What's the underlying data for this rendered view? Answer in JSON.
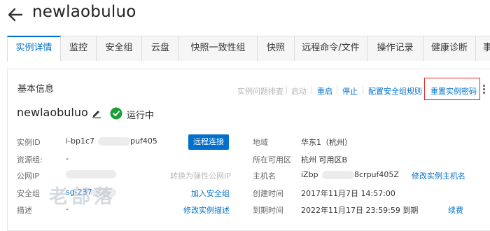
{
  "header": {
    "title": "newlaobuluo"
  },
  "tabs": [
    {
      "label": "实例详情"
    },
    {
      "label": "监控"
    },
    {
      "label": "安全组"
    },
    {
      "label": "云盘"
    },
    {
      "label": "快照一致性组"
    },
    {
      "label": "快照"
    },
    {
      "label": "远程命令/文件"
    },
    {
      "label": "操作记录"
    },
    {
      "label": "健康诊断"
    },
    {
      "label": "事件"
    }
  ],
  "panel": {
    "title": "基本信息",
    "actions": {
      "troubleshoot": "实例问题排查",
      "start": "启动",
      "restart": "重启",
      "stop": "停止",
      "config_sg_rules": "配置安全组规则",
      "reset_password": "重置实例密码"
    }
  },
  "instance": {
    "name": "newlaobuluo",
    "status": "运行中",
    "status_color": "#1aa035"
  },
  "details": {
    "instance_id": {
      "label": "实例ID",
      "value_a": "i-bp1c7",
      "value_b": "puf405",
      "action": "远程连接"
    },
    "resource_group": {
      "label": "资源组:",
      "value": "-"
    },
    "public_ip": {
      "label": "公网IP",
      "action": "转换为弹性公网IP"
    },
    "security_group": {
      "label": "安全组",
      "value": "sg-237",
      "action": "加入安全组"
    },
    "description": {
      "label": "描述",
      "value": "-",
      "action": "修改实例描述"
    },
    "region": {
      "label": "地域",
      "value": "华东1（杭州）"
    },
    "zone": {
      "label": "所在可用区",
      "value": "杭州 可用区B"
    },
    "hostname": {
      "label": "主机名",
      "value_a": "iZbp",
      "value_b": "8crpuf405Z",
      "action": "修改实例主机名"
    },
    "created": {
      "label": "创建时间",
      "value": "2017年11月7日 14:57:00"
    },
    "expires": {
      "label": "到期时间",
      "value": "2022年11月17日 23:59:59 到期",
      "action": "续费"
    }
  },
  "watermark": "老部落",
  "colors": {
    "accent": "#0070cc",
    "highlight_border": "#e5252a"
  }
}
